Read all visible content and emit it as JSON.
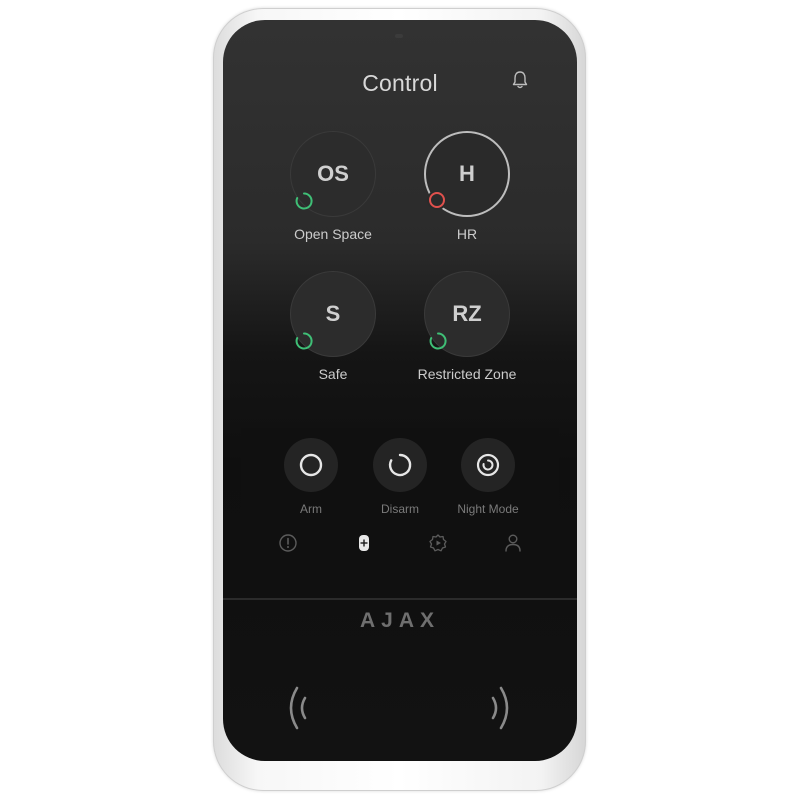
{
  "screen": {
    "title": "Control"
  },
  "groups": [
    {
      "abbr": "OS",
      "name": "Open Space",
      "status": "disarmed",
      "status_color": "#3fbf76",
      "selected": false
    },
    {
      "abbr": "H",
      "name": "HR",
      "status": "alarm",
      "status_color": "#e0514d",
      "selected": true
    },
    {
      "abbr": "S",
      "name": "Safe",
      "status": "disarmed",
      "status_color": "#3fbf76",
      "selected": false
    },
    {
      "abbr": "RZ",
      "name": "Restricted Zone",
      "status": "disarmed",
      "status_color": "#3fbf76",
      "selected": false
    }
  ],
  "actions": [
    {
      "label": "Arm",
      "icon": "arm-icon"
    },
    {
      "label": "Disarm",
      "icon": "disarm-icon"
    },
    {
      "label": "Night Mode",
      "icon": "night-mode-icon"
    }
  ],
  "tabs": [
    {
      "icon": "alert-icon",
      "active": false
    },
    {
      "icon": "control-icon",
      "active": true
    },
    {
      "icon": "scenarios-icon",
      "active": false
    },
    {
      "icon": "user-icon",
      "active": false
    }
  ],
  "brand": {
    "logo": "AJAX"
  },
  "colors": {
    "disarmed": "#3fbf76",
    "alarm": "#e0514d",
    "face": "#151515"
  }
}
